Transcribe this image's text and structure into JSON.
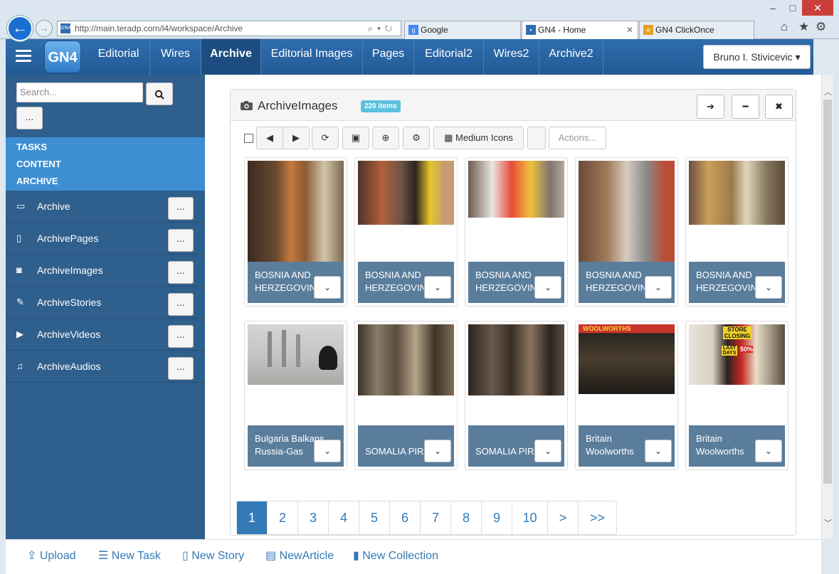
{
  "browser": {
    "url": "http://main.teradp.com/l4/workspace/Archive",
    "tabs": [
      {
        "label": "Google",
        "active": false
      },
      {
        "label": "GN4 - Home",
        "active": true
      },
      {
        "label": "GN4 ClickOnce",
        "active": false
      }
    ],
    "window_controls": [
      "–",
      "□",
      "✕"
    ]
  },
  "app": {
    "logo": "GN4",
    "nav": [
      "Editorial",
      "Wires",
      "Archive",
      "Editorial Images",
      "Pages",
      "Editorial2",
      "Wires2",
      "Archive2"
    ],
    "active_nav": "Archive",
    "user": "Bruno I. Stivicevic"
  },
  "sidebar": {
    "search_placeholder": "Search...",
    "more": "...",
    "sections": [
      "TASKS",
      "CONTENT",
      "ARCHIVE"
    ],
    "items": [
      {
        "icon": "folder-open-icon",
        "label": "Archive"
      },
      {
        "icon": "file-icon",
        "label": "ArchivePages"
      },
      {
        "icon": "camera-icon",
        "label": "ArchiveImages"
      },
      {
        "icon": "pencil-icon",
        "label": "ArchiveStories"
      },
      {
        "icon": "video-icon",
        "label": "ArchiveVideos"
      },
      {
        "icon": "headphones-icon",
        "label": "ArchiveAudios"
      }
    ]
  },
  "panel": {
    "title": "ArchiveImages",
    "badge": "220 items",
    "view_label": "Medium Icons",
    "actions_label": "Actions...",
    "cards": [
      {
        "caption": "BOSNIA AND\nHERZEGOVIN/"
      },
      {
        "caption": "BOSNIA AND\nHERZEGOVIN/"
      },
      {
        "caption": "BOSNIA AND\nHERZEGOVIN/"
      },
      {
        "caption": "BOSNIA AND\nHERZEGOVIN/"
      },
      {
        "caption": "BOSNIA AND\nHERZEGOVIN/"
      },
      {
        "caption": "Bulgaria Balkans\nRussia-Gas"
      },
      {
        "caption": "\nSOMALIA PIRA"
      },
      {
        "caption": "\nSOMALIA PIRA"
      },
      {
        "caption": "Britain\nWoolworths"
      },
      {
        "caption": "Britain\nWoolworths"
      }
    ],
    "image_text": {
      "sign1": "WOOLWORTHS",
      "sign2": "STORE CLOSING",
      "sign3": "LAST DAYS",
      "sign4": "50%"
    }
  },
  "pagination": [
    "1",
    "2",
    "3",
    "4",
    "5",
    "6",
    "7",
    "8",
    "9",
    "10",
    ">",
    ">>"
  ],
  "active_page": "1",
  "footer": [
    {
      "icon": "upload-icon",
      "label": "Upload"
    },
    {
      "icon": "list-icon",
      "label": "New Task"
    },
    {
      "icon": "file-icon",
      "label": "New Story"
    },
    {
      "icon": "article-icon",
      "label": "NewArticle"
    },
    {
      "icon": "collection-icon",
      "label": "New Collection"
    }
  ]
}
